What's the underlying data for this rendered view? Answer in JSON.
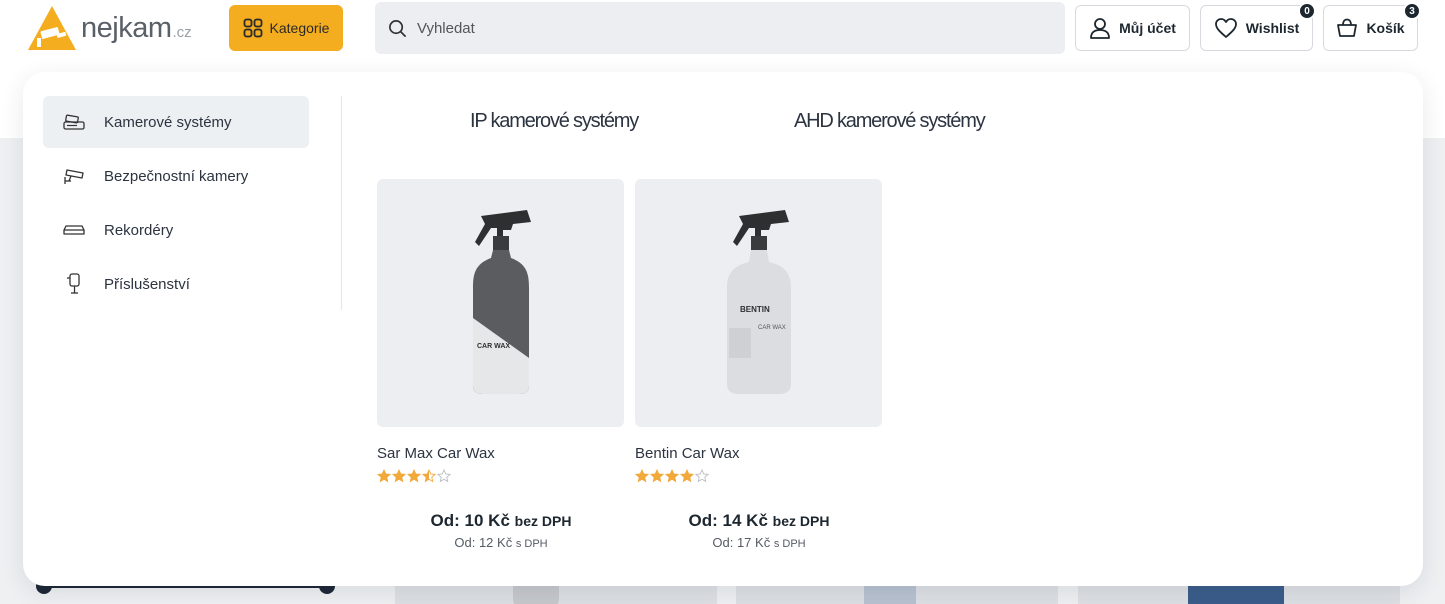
{
  "header": {
    "logo_text": "nejkam",
    "logo_tld": ".cz",
    "categories_button": "Kategorie",
    "search_placeholder": "Vyhledat",
    "account_label": "Můj účet",
    "wishlist_label": "Wishlist",
    "wishlist_count": "0",
    "cart_label": "Košík",
    "cart_count": "3"
  },
  "menu": {
    "categories": [
      {
        "label": "Kamerové systémy",
        "icon": "camera-system-icon",
        "active": true
      },
      {
        "label": "Bezpečnostní kamery",
        "icon": "security-camera-icon",
        "active": false
      },
      {
        "label": "Rekordéry",
        "icon": "recorder-icon",
        "active": false
      },
      {
        "label": "Příslušenství",
        "icon": "accessory-icon",
        "active": false
      }
    ],
    "subcategories": [
      "IP kamerové systémy",
      "AHD kamerové systémy"
    ],
    "products": [
      {
        "name": "Sar Max Car Wax",
        "rating": 3.5,
        "price_main": "Od: 10 Kč",
        "price_main_unit": "bez DPH",
        "price_vat": "Od: 12 Kč",
        "price_vat_unit": "s DPH",
        "bottle_label": "CAR WAX",
        "bottle_color": "#5a5c60"
      },
      {
        "name": "Bentin Car Wax",
        "rating": 4,
        "price_main": "Od: 14 Kč",
        "price_main_unit": "bez DPH",
        "price_vat": "Od: 17 Kč",
        "price_vat_unit": "s DPH",
        "bottle_label": "BENTIN",
        "bottle_sublabel": "CAR WAX",
        "bottle_color": "#dcdde0"
      }
    ]
  },
  "colors": {
    "accent": "#f4ad1f",
    "star": "#f2a93b",
    "dark": "#1d2730"
  }
}
